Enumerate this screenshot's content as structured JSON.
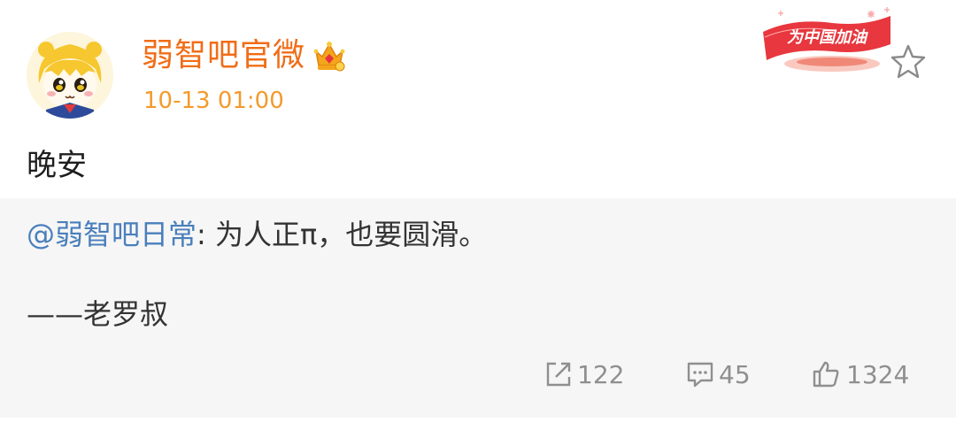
{
  "header": {
    "username": "弱智吧官微",
    "timestamp": "10-13 01:00",
    "avatar_icon": "cartoon-girl-avatar",
    "vip_icon": "crown-badge-icon",
    "campaign_badge_text": "为中国加油",
    "favorite_icon": "star-outline-icon",
    "accent_color": "#f06d17"
  },
  "post": {
    "text": "晚安"
  },
  "repost": {
    "mention": "@弱智吧日常",
    "content": ": 为人正π，也要圆滑。",
    "signature": "——老罗叔",
    "mention_color": "#4a7fbb"
  },
  "actions": {
    "repost_count": "122",
    "comment_count": "45",
    "like_count": "1324",
    "repost_icon": "share-icon",
    "comment_icon": "comment-icon",
    "like_icon": "thumbs-up-icon"
  }
}
